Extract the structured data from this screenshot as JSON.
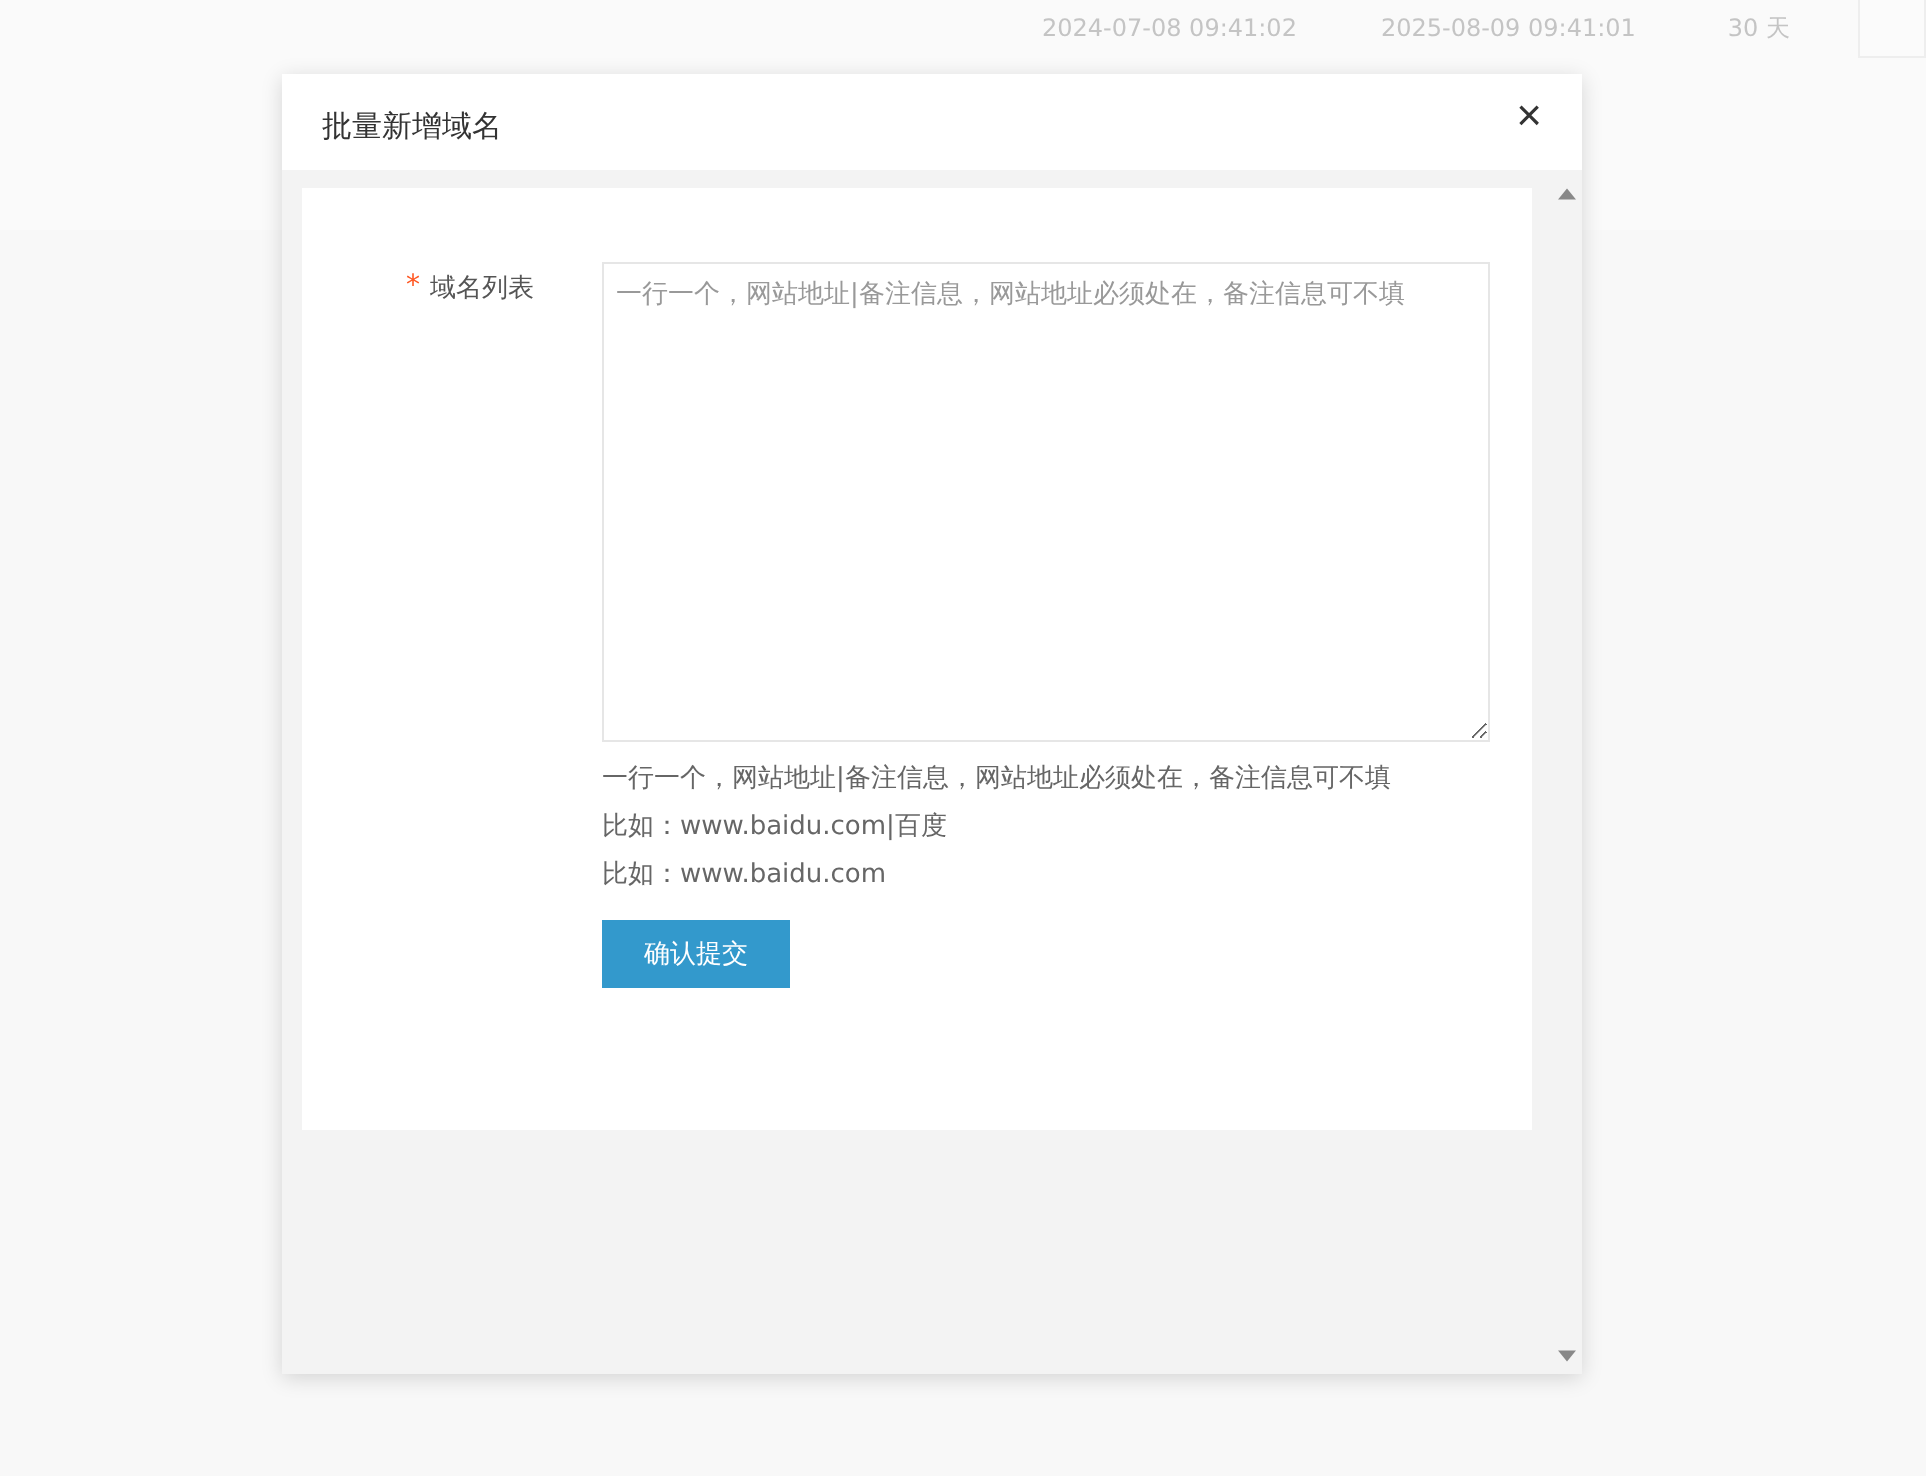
{
  "background_row": {
    "cells": [
      "2024-07-08 09:41:02",
      "2025-08-09 09:41:01",
      "30 天"
    ]
  },
  "dialog": {
    "title": "批量新增域名",
    "close": "×",
    "form": {
      "label": "域名列表",
      "required_mark": "*",
      "placeholder": "一行一个，网站地址|备注信息，网站地址必须处在，备注信息可不填",
      "hints": [
        "一行一个，网站地址|备注信息，网站地址必须处在，备注信息可不填",
        "比如：www.baidu.com|百度",
        "比如：www.baidu.com"
      ],
      "submit": "确认提交"
    }
  }
}
